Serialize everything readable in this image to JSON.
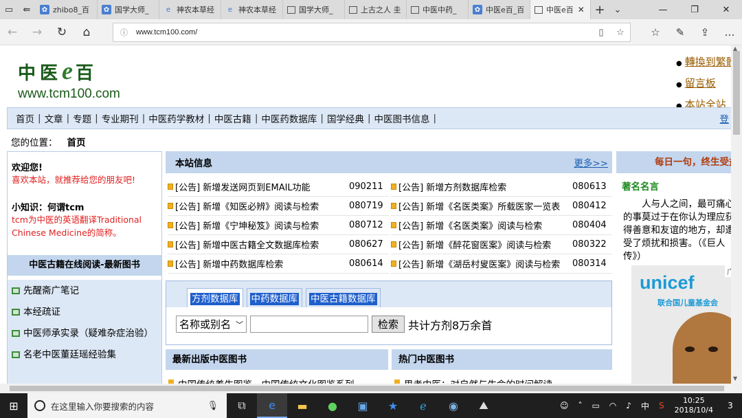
{
  "browser": {
    "tabs": [
      {
        "label": "zhibo8_百",
        "icon": "leaf-icon"
      },
      {
        "label": "国学大师_",
        "icon": "leaf-icon"
      },
      {
        "label": "神农本草经",
        "icon": "edge-icon"
      },
      {
        "label": "神农本草经",
        "icon": "edge-icon"
      },
      {
        "label": "国学大师_",
        "icon": "page-icon"
      },
      {
        "label": "上古之人 圭",
        "icon": "page-icon"
      },
      {
        "label": "中医中药_",
        "icon": "page-icon"
      },
      {
        "label": "中医e百_百",
        "icon": "leaf-icon"
      }
    ],
    "active_tab": "中医e百",
    "url": "www.tcm100.com/"
  },
  "site": {
    "logo_cn_1": "中医",
    "logo_e": "e",
    "logo_cn_2": "百",
    "logo_url": "www.tcm100.com",
    "top_links": [
      "轉換到繁體",
      "留言板",
      "本站全站"
    ]
  },
  "nav": {
    "items": [
      "首页",
      "文章",
      "专题",
      "专业期刊",
      "中医药学教材",
      "中医古籍",
      "中医药数据库",
      "国学经典",
      "中医图书信息"
    ],
    "sep": "|",
    "login": "登"
  },
  "crumb": {
    "label": "您的位置：",
    "current": "首页"
  },
  "left": {
    "welcome_title": "欢迎您!",
    "welcome_text": "喜欢本站，就推荐给您的朋友吧!",
    "tip_title": "小知识：何谓tcm",
    "tip_text": "tcm为中医的英语翻译Traditional Chinese Medicine的简称。",
    "books_header": "中医古籍在线阅读-最新图书",
    "books": [
      "先醒斋广笔记",
      "本经疏证",
      "中医师承实录（疑难杂症治验）",
      "名老中医董廷瑶经验集"
    ]
  },
  "notice": {
    "header": "本站信息",
    "more": "更多>>",
    "left_items": [
      {
        "text": "[公告] 新增发送网页到EMAIL功能",
        "date": "090211"
      },
      {
        "text": "[公告] 新增《知医必辨》阅读与检索",
        "date": "080719"
      },
      {
        "text": "[公告] 新增《宁坤秘笈》阅读与检索",
        "date": "080712"
      },
      {
        "text": "[公告] 新增中医古籍全文数据库检索",
        "date": "080627"
      },
      {
        "text": "[公告] 新增中药数据库检索",
        "date": "080614"
      }
    ],
    "right_items": [
      {
        "text": "[公告] 新增方剂数据库检索",
        "date": "080613"
      },
      {
        "text": "[公告] 新增《名医类案》所载医家一览表",
        "date": "080412"
      },
      {
        "text": "[公告] 新增《名医类案》阅读与检索",
        "date": "080404"
      },
      {
        "text": "[公告] 新增《醉花窗医案》阅读与检索",
        "date": "080322"
      },
      {
        "text": "[公告] 新增《湖岳村叟医案》阅读与检索",
        "date": "080314"
      }
    ]
  },
  "search": {
    "tabs": [
      "方剂数据库",
      "中药数据库",
      "中医古籍数据库"
    ],
    "select_value": "名称或别名",
    "button": "检索",
    "total": "共计方剂8万余首"
  },
  "new_books": {
    "header": "最新出版中医图书",
    "first": "中国传统养生图鉴—中国传统文化图鉴系列"
  },
  "hot_books": {
    "header": "热门中医图书",
    "first": "思考中医：对自然与生命的时间解读"
  },
  "right": {
    "header": "每日一句，终生受益",
    "title": "著名名言",
    "quote": "人与人之间，最可痛心的事莫过于在你认为理应获得善意和友谊的地方，却遭受了烦扰和损害。（《巨人传》）",
    "ad_brand": "unicef",
    "ad_cn": "联合国儿童基金会",
    "ad_tag": "广"
  },
  "taskbar": {
    "search_placeholder": "在这里输入你要搜索的内容",
    "ime": "中",
    "time": "10:25",
    "date": "2018/10/4",
    "notif_count": "3"
  }
}
